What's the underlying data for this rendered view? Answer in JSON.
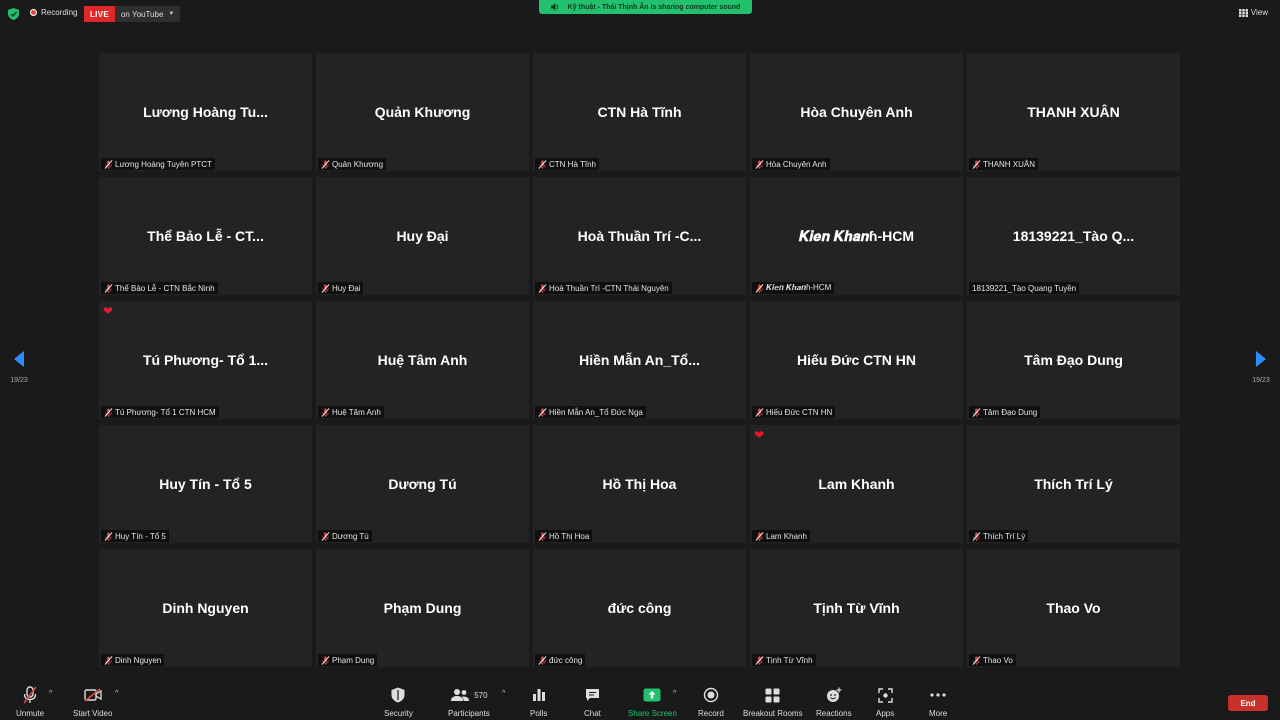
{
  "topbar": {
    "recording_label": "Recording",
    "live_label": "LIVE",
    "live_destination": "on YouTube",
    "share_banner": "Kỹ thuật - Thái Thịnh Ân is sharing computer sound",
    "view_label": "View"
  },
  "navigation": {
    "page_indicator_left": "19/23",
    "page_indicator_right": "19/23"
  },
  "participants": [
    {
      "display": "Lương  Hoàng  Tu...",
      "label": "Lương Hoàng Tuyên PTCT",
      "muted": true,
      "reaction": ""
    },
    {
      "display": "Quản Khương",
      "label": "Quản Khương",
      "muted": true,
      "reaction": ""
    },
    {
      "display": "CTN Hà Tĩnh",
      "label": "CTN Hà Tĩnh",
      "muted": true,
      "reaction": ""
    },
    {
      "display": "Hòa Chuyên Anh",
      "label": "Hòa Chuyên Anh",
      "muted": true,
      "reaction": ""
    },
    {
      "display": "THANH XUÂN",
      "label": "THANH XUÂN",
      "muted": true,
      "reaction": ""
    },
    {
      "display": "Thể Bảo Lễ - CT...",
      "label": "Thể Bảo Lễ - CTN Bắc Ninh",
      "muted": true,
      "reaction": ""
    },
    {
      "display": "Huy Đại",
      "label": "Huy Đại",
      "muted": true,
      "reaction": ""
    },
    {
      "display": "Hoà Thuần Trí -C...",
      "label": "Hoà Thuần Trí -CTN Thái Nguyên",
      "muted": true,
      "reaction": ""
    },
    {
      "display": "𝑲𝒊𝒆𝒏 𝑲𝒉𝒂𝒏ɦ-HCM",
      "label": "𝑲𝒊𝒆𝒏 𝑲𝒉𝒂𝒏ɦ-HCM",
      "muted": true,
      "reaction": ""
    },
    {
      "display": "18139221_Tào Q...",
      "label": "18139221_Tào Quang Tuyền",
      "muted": false,
      "reaction": ""
    },
    {
      "display": "Tú Phương- Tổ 1...",
      "label": "Tú Phương- Tổ 1 CTN HCM",
      "muted": true,
      "reaction": "❤"
    },
    {
      "display": "Huệ Tâm Anh",
      "label": "Huệ Tâm Anh",
      "muted": true,
      "reaction": ""
    },
    {
      "display": "Hiền Mẫn An_Tổ...",
      "label": "Hiền Mẫn An_Tổ Đức Nga",
      "muted": true,
      "reaction": ""
    },
    {
      "display": "Hiếu Đức CTN HN",
      "label": "Hiếu Đức CTN HN",
      "muted": true,
      "reaction": ""
    },
    {
      "display": "Tâm Đạo Dung",
      "label": "Tâm Đạo Dung",
      "muted": true,
      "reaction": ""
    },
    {
      "display": "Huy Tín - Tổ 5",
      "label": "Huy Tín - Tổ 5",
      "muted": true,
      "reaction": ""
    },
    {
      "display": "Dương Tú",
      "label": "Dương Tú",
      "muted": true,
      "reaction": ""
    },
    {
      "display": "Hồ Thị Hoa",
      "label": "Hồ Thị Hoa",
      "muted": true,
      "reaction": ""
    },
    {
      "display": "Lam Khanh",
      "label": "Lam Khanh",
      "muted": true,
      "reaction": "❤"
    },
    {
      "display": "Thích Trí Lý",
      "label": "Thích Trí Lý",
      "muted": true,
      "reaction": ""
    },
    {
      "display": "Dinh Nguyen",
      "label": "Dinh Nguyen",
      "muted": true,
      "reaction": ""
    },
    {
      "display": "Phạm Dung",
      "label": "Phạm Dung",
      "muted": true,
      "reaction": ""
    },
    {
      "display": "đức công",
      "label": "đức công",
      "muted": true,
      "reaction": ""
    },
    {
      "display": "Tịnh Từ Vĩnh",
      "label": "Tịnh Từ Vĩnh",
      "muted": true,
      "reaction": ""
    },
    {
      "display": "Thao Vo",
      "label": "Thao Vo",
      "muted": true,
      "reaction": ""
    }
  ],
  "toolbar": {
    "unmute": "Unmute",
    "start_video": "Start Video",
    "security": "Security",
    "participants": "Participants",
    "participants_count": "570",
    "polls": "Polls",
    "chat": "Chat",
    "share_screen": "Share Screen",
    "record": "Record",
    "breakout_rooms": "Breakout Rooms",
    "reactions": "Reactions",
    "apps": "Apps",
    "more": "More",
    "end": "End"
  },
  "colors": {
    "live": "#e02828",
    "share": "#23c16e",
    "end": "#c8312b",
    "nav_arrow": "#2d8cff",
    "muted_icon": "#e04848"
  },
  "icons": [
    "shield-icon",
    "recording-icon",
    "caret-icon",
    "speaker-icon",
    "grid-view-icon",
    "muted-mic-icon",
    "heart-icon",
    "chevron-left-icon",
    "chevron-right-icon",
    "mic-off-icon",
    "video-off-icon",
    "security-shield-icon",
    "participants-icon",
    "polls-icon",
    "chat-icon",
    "share-screen-icon",
    "record-icon",
    "breakout-rooms-icon",
    "reactions-icon",
    "apps-icon",
    "more-icon"
  ]
}
